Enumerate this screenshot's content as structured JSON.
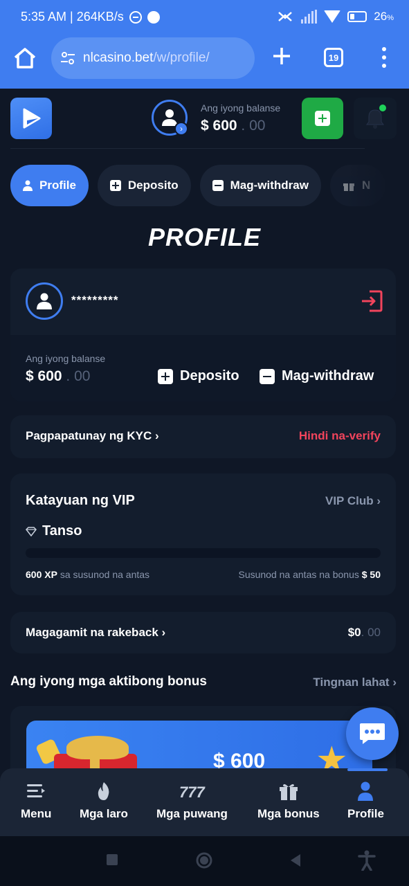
{
  "status_bar": {
    "time_speed": "5:35 AM | 264KB/s",
    "battery": "26",
    "battery_unit": "%"
  },
  "browser": {
    "url_host": "nlcasino.bet",
    "url_path": "/w/profile/",
    "tab_count": "19"
  },
  "header": {
    "balance_label": "Ang iyong balanse",
    "balance_whole": "$ 600",
    "balance_cents": ". 00",
    "accent": "#3f7df0",
    "deposit_color": "#1faa45"
  },
  "tabs": [
    {
      "label": "Profile",
      "icon": "user-icon",
      "active": true
    },
    {
      "label": "Deposito",
      "icon": "plus-box-icon"
    },
    {
      "label": "Mag-withdraw",
      "icon": "minus-box-icon"
    },
    {
      "label": "N",
      "icon": "gift-icon"
    }
  ],
  "page_title": "PROFILE",
  "user_card": {
    "username": "*********",
    "balance_label": "Ang iyong balanse",
    "balance_whole": "$ 600",
    "balance_cents": ". 00",
    "deposit_label": "Deposito",
    "withdraw_label": "Mag-withdraw"
  },
  "kyc": {
    "label": "Pagpapatunay ng KYC",
    "status": "Hindi na-verify",
    "status_color": "#f2445c"
  },
  "vip": {
    "title": "Katayuan ng VIP",
    "club_link": "VIP Club",
    "tier": "Tanso",
    "progress": 0,
    "xp_value": "600 XP",
    "xp_text": "sa susunod na antas",
    "bonus_text": "Susunod na antas na bonus",
    "bonus_value": "$ 50"
  },
  "rakeback": {
    "label": "Magagamit na rakeback",
    "value_whole": "$0",
    "value_cents": ". 00"
  },
  "bonuses": {
    "heading": "Ang iyong mga aktibong bonus",
    "see_all": "Tingnan lahat",
    "amount": "$ 600"
  },
  "bottom_nav": [
    {
      "label": "Menu",
      "icon": "menu-icon"
    },
    {
      "label": "Mga laro",
      "icon": "fire-icon"
    },
    {
      "label": "Mga puwang",
      "icon": "slot-777-icon"
    },
    {
      "label": "Mga bonus",
      "icon": "gift-icon"
    },
    {
      "label": "Profile",
      "icon": "user-icon",
      "active": true
    }
  ]
}
